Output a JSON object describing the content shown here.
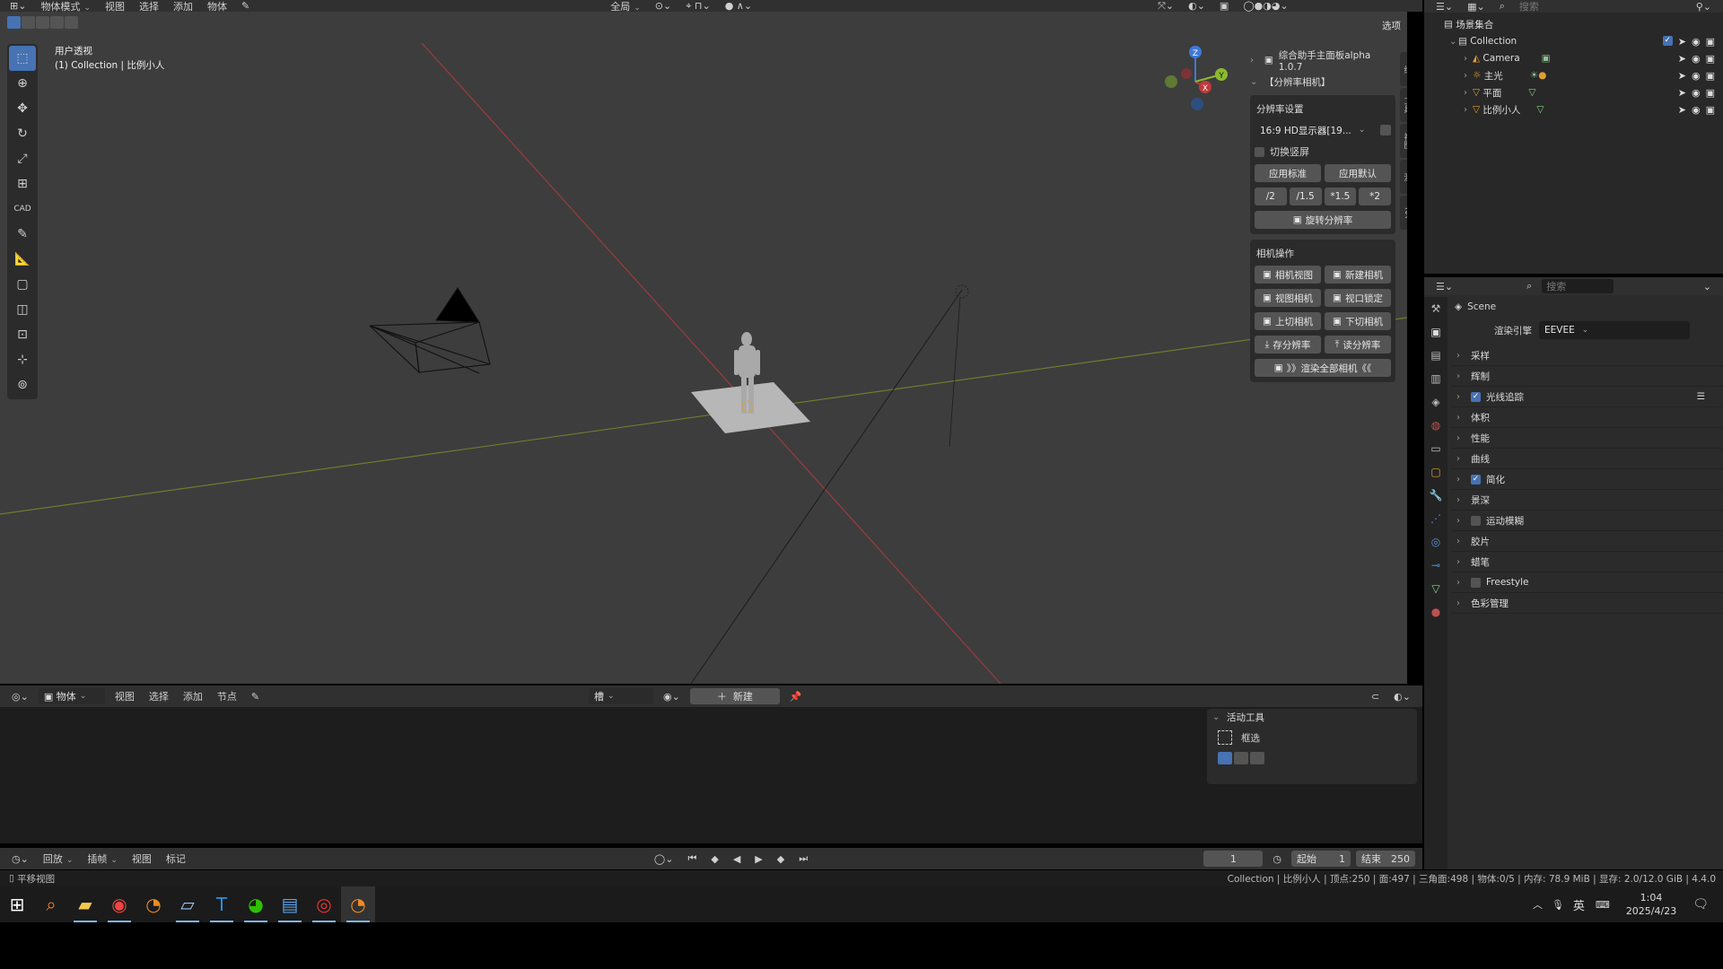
{
  "topbar": {
    "mode": "物体模式",
    "menus": [
      "视图",
      "选择",
      "添加",
      "物体"
    ],
    "global": "全局",
    "options": "选项"
  },
  "viewport": {
    "view_name": "用户透视",
    "collection_line": "(1) Collection | 比例小人"
  },
  "npanel": {
    "header_title": "综合助手主面板alpha 1.0.7",
    "section": "【分辨率相机】",
    "res_settings": "分辨率设置",
    "preset": "16:9 HD显示器[19...",
    "portrait": "切换竖屏",
    "apply_std": "应用标准",
    "apply_def": "应用默认",
    "scale": [
      "/2",
      "/1.5",
      "*1.5",
      "*2"
    ],
    "rotate_res": "旋转分辨率",
    "cam_ops": "相机操作",
    "cam_btns": [
      "相机视图",
      "新建相机",
      "视图相机",
      "视口锁定",
      "上切相机",
      "下切相机",
      "存分辨率",
      "读分辨率"
    ],
    "render_all": "》》渲染全部相机《《",
    "vtabs": [
      "综",
      "工具",
      "视图",
      "测",
      "RA"
    ]
  },
  "outliner": {
    "search_placeholder": "搜索",
    "scene_collection": "场景集合",
    "collection": "Collection",
    "items": [
      "Camera",
      "主光",
      "平面",
      "比例小人"
    ]
  },
  "properties": {
    "search_placeholder": "搜索",
    "scene": "Scene",
    "engine_label": "渲染引擎",
    "engine": "EEVEE",
    "sections": [
      "采样",
      "辉制",
      "光线追踪",
      "体积",
      "性能",
      "曲线",
      "简化",
      "景深",
      "运动模糊",
      "胶片",
      "蜡笔",
      "Freestyle",
      "色彩管理"
    ]
  },
  "node_editor": {
    "mode": "物体",
    "menus": [
      "视图",
      "选择",
      "添加",
      "节点"
    ],
    "slot": "槽",
    "new_btn": "新建",
    "active_tool": "活动工具",
    "tool_name": "框选"
  },
  "timeline": {
    "menus": [
      "回放",
      "插帧",
      "视图",
      "标记"
    ],
    "current_frame": "1",
    "start_label": "起始",
    "start": "1",
    "end_label": "结束",
    "end": "250"
  },
  "status": {
    "left": "平移视图",
    "right": "Collection | 比例小人 | 顶点:250 | 面:497 | 三角面:498 | 物体:0/5 | 内存: 78.9 MiB | 显存: 2.0/12.0 GiB | 4.4.0"
  },
  "taskbar": {
    "ime": "英",
    "time": "1:04",
    "date": "2025/4/23"
  },
  "colors": {
    "accent": "#4772b3",
    "xaxis": "#c0393c",
    "yaxis": "#8cba2e",
    "zaxis": "#3e7ad6"
  }
}
